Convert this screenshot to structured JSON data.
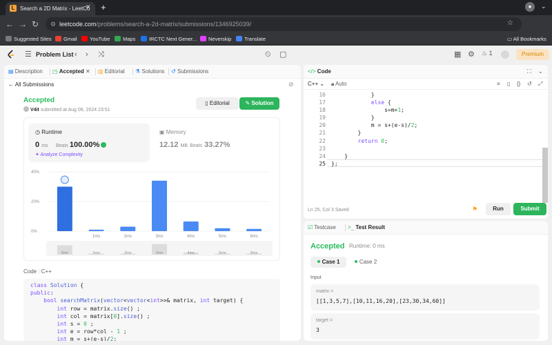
{
  "browser": {
    "tab_title": "Search a 2D Matrix - LeetCo",
    "url_host": "leetcode.com",
    "url_path": "/problems/search-a-2d-matrix/submissions/1346925039/",
    "bookmarks": [
      {
        "label": "Suggested Sites",
        "color": "#7a7a7a"
      },
      {
        "label": "Gmail",
        "color": "#e94235"
      },
      {
        "label": "YouTube",
        "color": "#ff0000"
      },
      {
        "label": "Maps",
        "color": "#34a853"
      },
      {
        "label": "IRCTC Next Gener...",
        "color": "#1a73e8"
      },
      {
        "label": "Neverskip",
        "color": "#e040fb"
      },
      {
        "label": "Translate",
        "color": "#4285f4"
      }
    ],
    "all_bookmarks": "All Bookmarks"
  },
  "header": {
    "problem_list": "Problem List",
    "streak": "1",
    "premium": "Premium"
  },
  "left": {
    "tabs": {
      "description": "Description",
      "accepted": "Accepted",
      "editorial": "Editorial",
      "solutions": "Solutions",
      "submissions": "Submissions"
    },
    "back": "All Submissions",
    "status": "Accepted",
    "user": "V4it",
    "submitted": "submitted at Aug 06, 2024 23:51",
    "editorial_btn": "Editorial",
    "solution_btn": "Solution",
    "runtime": {
      "label": "Runtime",
      "value": "0",
      "unit": "ms",
      "beats_label": "Beats",
      "beats": "100.00%",
      "analyze": "Analyze Complexity"
    },
    "memory": {
      "label": "Memory",
      "value": "12.12",
      "unit": "MB",
      "beats_label": "Beats",
      "beats": "33.27%"
    },
    "code_label": "Code",
    "language": "C++"
  },
  "chart_data": {
    "type": "bar",
    "categories": [
      "0ms",
      "1ms",
      "2ms",
      "3ms",
      "4ms",
      "5ms",
      "6ms"
    ],
    "values": [
      30,
      1,
      3,
      34,
      6.5,
      2,
      1.5
    ],
    "ylim": [
      0,
      40
    ],
    "yticks": [
      "40%",
      "20%",
      "0%"
    ],
    "highlight_index": 0
  },
  "code": {
    "title": "Code",
    "language": "C++",
    "auto": "Auto",
    "line_numbers": [
      "16",
      "17",
      "18",
      "19",
      "20",
      "21",
      "22",
      "23",
      "24",
      "25"
    ],
    "status": "Ln 25, Col 3",
    "saved": "Saved",
    "run": "Run",
    "submit": "Submit"
  },
  "test": {
    "tab_testcase": "Testcase",
    "tab_result": "Test Result",
    "status": "Accepted",
    "runtime": "Runtime: 0 ms",
    "case1": "Case 1",
    "case2": "Case 2",
    "input_label": "Input",
    "inputs": [
      {
        "name": "matrix =",
        "value": "[[1,3,5,7],[10,11,16,20],[23,30,34,60]]"
      },
      {
        "name": "target =",
        "value": "3"
      }
    ]
  }
}
